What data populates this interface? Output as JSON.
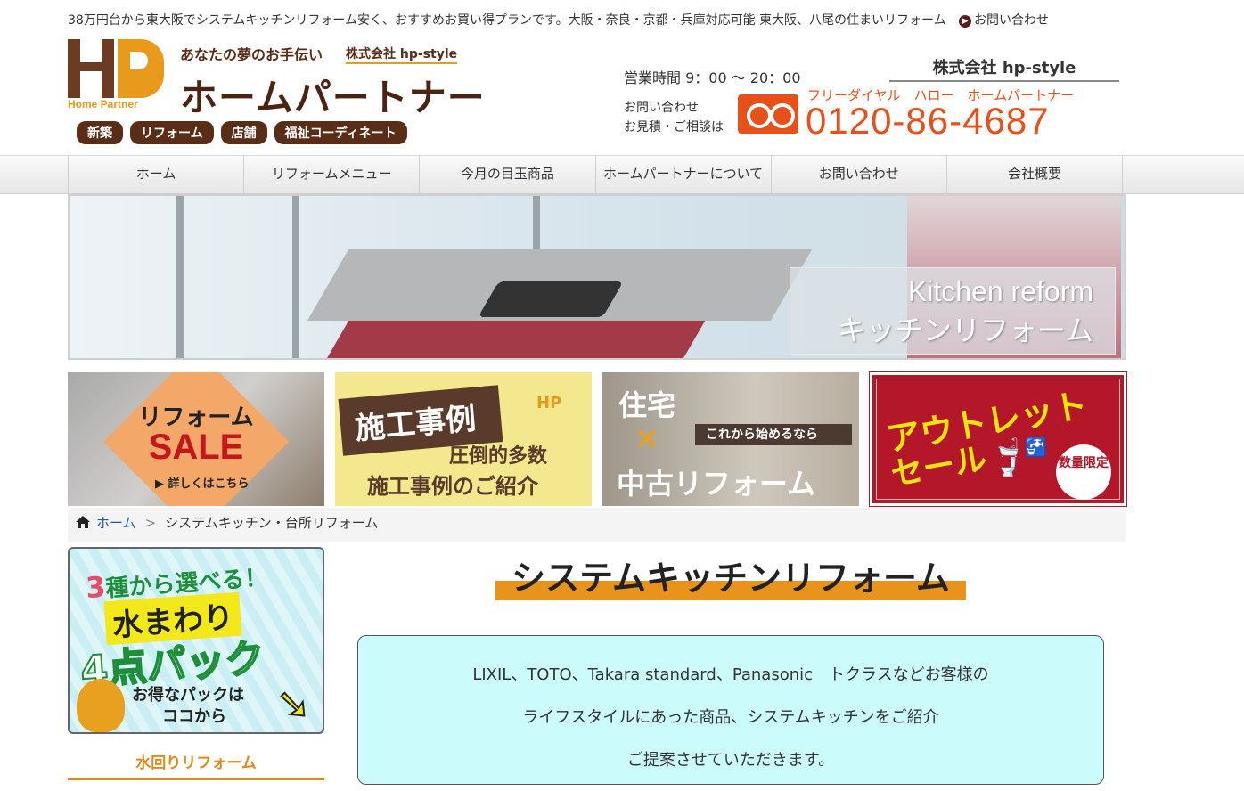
{
  "header": {
    "tagline": "38万円台から東大阪でシステムキッチンリフォーム安く、おすすめお買い得プランです。大阪・奈良・京都・兵庫対応可能 東大阪、八尾の住まいリフォーム",
    "contact_link": "お問い合わせ"
  },
  "logo": {
    "mark_text": "HP",
    "mark_sub": "Home Partner",
    "catchphrase": "あなたの夢のお手伝い",
    "company_small": "株式会社 hp-style",
    "name": "ホームパートナー",
    "tags": [
      "新築",
      "リフォーム",
      "店舗",
      "福祉コーディネート"
    ]
  },
  "phone": {
    "company": "株式会社 hp-style",
    "hours": "営業時間 9：00 〜 20：00",
    "label1": "お問い合わせ",
    "label2": "お見積・ご相談は",
    "freedial_label": "フリーダイヤル　ハロー　ホームパートナー",
    "number": "0120-86-4687"
  },
  "nav": {
    "items": [
      "ホーム",
      "リフォームメニュー",
      "今月の目玉商品",
      "ホームパートナーについて",
      "お問い合わせ",
      "会社概要"
    ]
  },
  "hero": {
    "caption_en": "Kitchen reform",
    "caption_ja": "キッチンリフォーム"
  },
  "promos": {
    "sale": {
      "line1": "リフォーム",
      "line2": "SALE",
      "line3": "▶ 詳しくはこちら"
    },
    "case": {
      "line1": "施工事例",
      "logo": "HP",
      "line2": "圧倒的多数",
      "line3": "施工事例のご紹介"
    },
    "used": {
      "line1": "住宅",
      "cross": "×",
      "tag": "これから始めるなら",
      "line2": "中古リフォーム"
    },
    "outlet": {
      "line1": "アウトレット",
      "line2": "セール",
      "badge": "数量限定"
    }
  },
  "breadcrumb": {
    "home": "ホーム",
    "separator": ">",
    "current": "システムキッチン・台所リフォーム"
  },
  "sidebar": {
    "banner": {
      "num": "3",
      "line1": "種から選べる！",
      "line2": "水まわり",
      "line3": "4点パック",
      "line4": "お得なパックは",
      "line5": "ココから"
    },
    "heading": "水回りリフォーム"
  },
  "main": {
    "title": "システムキッチンリフォーム",
    "intro": [
      "LIXIL、TOTO、Takara standard、Panasonic　トクラスなどお客様の",
      "ライフスタイルにあった商品、システムキッチンをご紹介",
      "ご提案させていただきます。"
    ]
  },
  "colors": {
    "brand_brown": "#5a2d17",
    "brand_orange": "#e89a1c",
    "phone_orange": "#e8501a",
    "link_blue": "#1a5ea8",
    "intro_bg": "#ccfbfc"
  }
}
